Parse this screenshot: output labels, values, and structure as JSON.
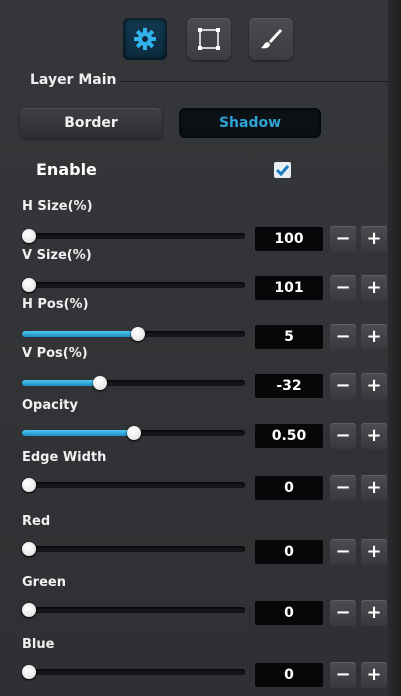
{
  "toolbar": {
    "icons": [
      "gear-icon",
      "frame-icon",
      "brush-icon"
    ],
    "active": "gear-icon"
  },
  "section": {
    "title": "Layer Main"
  },
  "tabs": [
    {
      "label": "Border",
      "active": false
    },
    {
      "label": "Shadow",
      "active": true
    }
  ],
  "enable": {
    "label": "Enable",
    "checked": true
  },
  "sliders": [
    {
      "label": "H Size(%)",
      "value": "100",
      "level": 0.0
    },
    {
      "label": "V Size(%)",
      "value": "101",
      "level": 0.0
    },
    {
      "label": "H Pos(%)",
      "value": "5",
      "level": 0.52
    },
    {
      "label": "V Pos(%)",
      "value": "-32",
      "level": 0.35
    },
    {
      "label": "Opacity",
      "value": "0.50",
      "level": 0.5
    },
    {
      "label": "Edge Width",
      "value": "0",
      "level": 0.0
    },
    {
      "label": "Red",
      "value": "0",
      "level": 0.0
    },
    {
      "label": "Green",
      "value": "0",
      "level": 0.0
    },
    {
      "label": "Blue",
      "value": "0",
      "level": 0.0
    }
  ],
  "stepper": {
    "minus": "−",
    "plus": "+"
  },
  "colors": {
    "accent": "#2fa4d6",
    "fill": "#1a8fc4",
    "panel": "#2f3134"
  }
}
